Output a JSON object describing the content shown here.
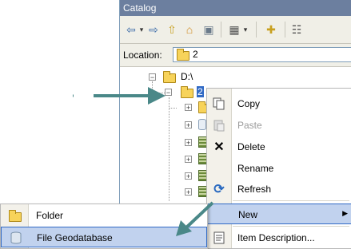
{
  "catalog": {
    "title": "Catalog",
    "location_label": "Location:",
    "location_value": "2",
    "tree": {
      "root_label": "D:\\",
      "selected_label": "2"
    }
  },
  "context_menu": {
    "items": [
      {
        "label": "Copy",
        "icon": "copy-icon",
        "enabled": true
      },
      {
        "label": "Paste",
        "icon": "paste-icon",
        "enabled": false
      },
      {
        "label": "Delete",
        "icon": "delete-icon",
        "enabled": true
      },
      {
        "label": "Rename",
        "icon": "",
        "enabled": true
      },
      {
        "label": "Refresh",
        "icon": "refresh-icon",
        "enabled": true
      },
      {
        "label": "New",
        "icon": "",
        "enabled": true,
        "highlighted": true,
        "has_submenu": true
      },
      {
        "label": "Item Description...",
        "icon": "item-description-icon",
        "enabled": true
      }
    ]
  },
  "submenu": {
    "items": [
      {
        "label": "Folder",
        "icon": "folder-icon"
      },
      {
        "label": "File Geodatabase",
        "icon": "file-geodatabase-icon",
        "highlighted": true
      }
    ]
  },
  "colors": {
    "title_bar": "#6c7f9f",
    "highlight": "#c1d2ee",
    "selection": "#316ac5",
    "arrow": "#4a8888"
  }
}
